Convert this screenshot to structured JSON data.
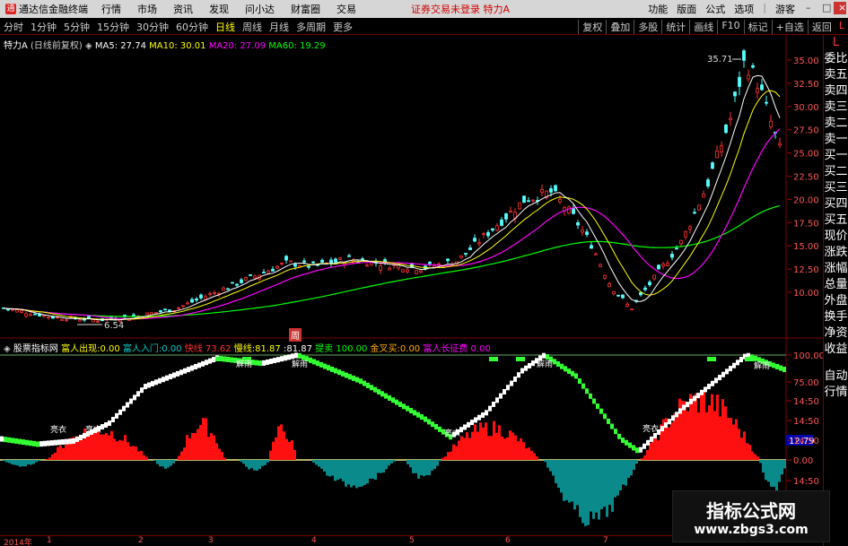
{
  "menubar": {
    "app_name": "通达信金融终端",
    "menus": [
      "行情",
      "市场",
      "资讯",
      "发现",
      "问小达",
      "财富圈",
      "交易"
    ],
    "notice": "证券交易未登录 特力A",
    "right": [
      "功能",
      "版面",
      "公式",
      "选项"
    ],
    "login": "游客"
  },
  "periodbar": {
    "periods": [
      "分时",
      "1分钟",
      "5分钟",
      "15分钟",
      "30分钟",
      "60分钟",
      "日线",
      "周线",
      "月线",
      "多周期",
      "更多"
    ],
    "active": "日线",
    "right": [
      "复权",
      "叠加",
      "多股",
      "统计",
      "画线",
      "F10",
      "标记",
      "+自选",
      "返回"
    ],
    "l_mark": "L"
  },
  "legend1": {
    "stock": "特力A",
    "mode": "(日线前复权)",
    "ma5": "MA5: 27.74",
    "ma10": "MA10: 30.01",
    "ma20": "MA20: 27.09",
    "ma60": "MA60: 19.29"
  },
  "legend2": {
    "name": "股票指标网",
    "items": [
      {
        "label": "富人出现:",
        "value": "0.00",
        "color": "yellow"
      },
      {
        "label": "富人入门:",
        "value": "0.00",
        "color": "cyan"
      },
      {
        "label": "快线",
        "value": "73.62",
        "color": "red"
      },
      {
        "label": "慢线:",
        "value": "81.87",
        "color": "yellow"
      },
      {
        "label": ":",
        "value": "81.87",
        "color": "white"
      },
      {
        "label": "提卖",
        "value": "100.00",
        "color": "green"
      },
      {
        "label": "金叉买:",
        "value": "0.00",
        "color": "orange"
      },
      {
        "label": "富人长征费",
        "value": "0.00",
        "color": "magenta"
      }
    ],
    "badge": "周"
  },
  "main_chart": {
    "high_label": "35.71",
    "low_label": "6.54",
    "scale": [
      "35.00",
      "32.50",
      "30.00",
      "27.50",
      "25.00",
      "22.50",
      "20.00",
      "17.50",
      "15.00",
      "12.50",
      "10.00"
    ],
    "colors": {
      "up": "#ff3030",
      "down": "#54ffff",
      "ma5": "#ffffff",
      "ma10": "#ffff00",
      "ma20": "#ff00ff",
      "ma60": "#00ff00"
    }
  },
  "indicator": {
    "scale": [
      "100.00",
      "75.00",
      "14:50",
      "14:50",
      "14:50",
      "0.00",
      "14:50",
      "14:50"
    ],
    "value_box": "12.79",
    "labels": [
      {
        "text": "亮衣"
      },
      {
        "text": "亮衣"
      },
      {
        "text": "亮衣"
      },
      {
        "text": "亮衣"
      },
      {
        "text": "解雨"
      },
      {
        "text": "解雨"
      },
      {
        "text": "解雨"
      },
      {
        "text": "解雨"
      }
    ]
  },
  "sidebar": {
    "top": "L",
    "items": [
      "委比",
      "卖五",
      "卖四",
      "卖三",
      "卖二",
      "卖一",
      "买一",
      "买二",
      "买三",
      "买四",
      "买五",
      "现价",
      "涨跌",
      "涨幅",
      "总量",
      "外盘",
      "换手",
      "净资",
      "收益"
    ],
    "bottom": [
      "自动",
      "行情"
    ]
  },
  "datebar": {
    "labels": [
      "2014年",
      "1",
      "2",
      "3",
      "4",
      "5",
      "6",
      "7"
    ]
  },
  "watermark": {
    "line1": "指标公式网",
    "line2": "www.zbgs3.com"
  }
}
